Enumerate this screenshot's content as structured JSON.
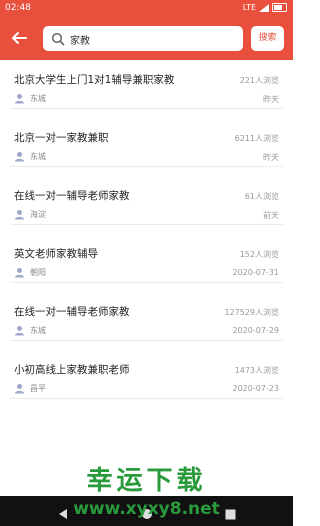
{
  "status": {
    "time": "02:48",
    "network": "LTE"
  },
  "search": {
    "query": "家教",
    "button_label": "搜索"
  },
  "items": [
    {
      "title": "北京大学生上门1对1辅导兼职家教",
      "views": "221人浏览",
      "location": "东城",
      "date": "昨天"
    },
    {
      "title": "北京一对一家教兼职",
      "views": "6211人浏览",
      "location": "东城",
      "date": "昨天"
    },
    {
      "title": "在线一对一辅导老师家教",
      "views": "61人浏览",
      "location": "海淀",
      "date": "前天"
    },
    {
      "title": "英文老师家教辅导",
      "views": "152人浏览",
      "location": "朝阳",
      "date": "2020-07-31"
    },
    {
      "title": "在线一对一辅导老师家教",
      "views": "127529人浏览",
      "location": "东城",
      "date": "2020-07-29"
    },
    {
      "title": "小初高线上家教兼职老师",
      "views": "1473人浏览",
      "location": "昌平",
      "date": "2020-07-23"
    }
  ],
  "watermark": {
    "text": "幸运下载",
    "url": "www.xyxy8.net"
  },
  "colors": {
    "primary": "#e84f3c",
    "watermark": "#2a9b3c"
  }
}
